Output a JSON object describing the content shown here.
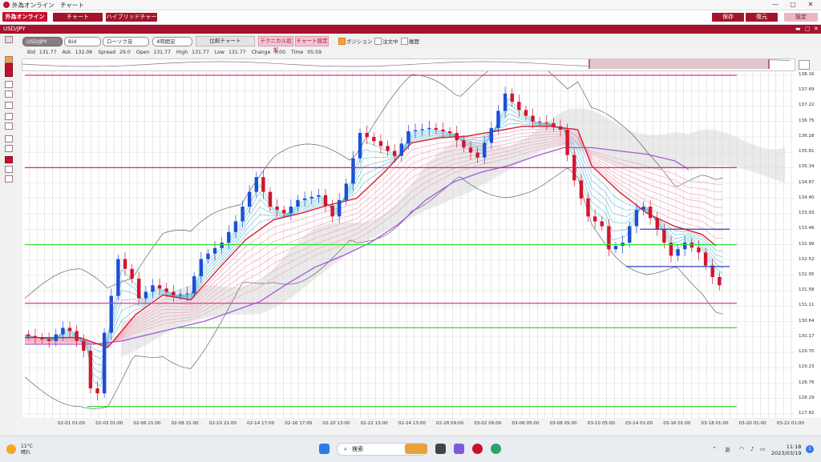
{
  "window": {
    "title": "外為オンライン　チャート",
    "minimize": "—",
    "maximize": "▢",
    "close": "✕"
  },
  "menubar": {
    "logo_text": "外為オンライン",
    "buttons": [
      "チャート",
      "ハイブリッドチャート"
    ],
    "save_label": "保存",
    "restore_label": "復元",
    "settings_label": "設定"
  },
  "pairbar": {
    "pair": "USD/JPY",
    "minimize": "▬",
    "maximize": "▢",
    "close": "✕"
  },
  "toolbar": {
    "symbol": "USD/JPY",
    "price_type": "Bid",
    "chart_type": "ローソク足",
    "timeframe": "4時間足",
    "compare_label": "比較チャート",
    "technical_add_label": "テクニカル追加",
    "chart_settings_label": "チャート設定",
    "position_label": "ポジション",
    "orders_label": "注文中",
    "history_label": "履歴",
    "position_checked": true,
    "orders_checked": false,
    "history_checked": false
  },
  "quote": {
    "bid_label": "Bid",
    "bid": "131.77",
    "ask_label": "Ask",
    "ask": "132.06",
    "spread_label": "Spread",
    "spread": "29.0",
    "open_label": "Open",
    "open": "131.77",
    "high_label": "High",
    "high": "131.77",
    "low_label": "Low",
    "low": "131.77",
    "change_label": "Change",
    "change": "0.00",
    "time_label": "Time",
    "time": "05:59"
  },
  "chart_data": {
    "type": "line",
    "pair": "USD/JPY",
    "timeframe": "4h",
    "y_ticks": [
      "138.16",
      "137.69",
      "137.22",
      "136.75",
      "136.28",
      "135.81",
      "135.34",
      "134.87",
      "134.40",
      "133.93",
      "133.46",
      "132.99",
      "132.52",
      "132.05",
      "131.58",
      "131.11",
      "130.64",
      "130.17",
      "129.70",
      "129.23",
      "128.76",
      "128.29",
      "127.82"
    ],
    "ylim": [
      127.82,
      138.16
    ],
    "x_ticks": [
      "02-01 01:00",
      "02-03 01:00",
      "02-06 21:00",
      "02-08 21:00",
      "02-10 21:00",
      "02-14 17:00",
      "02-16 17:00",
      "02-20 13:00",
      "02-22 13:00",
      "02-24 13:00",
      "02-28 09:00",
      "03-02 09:00",
      "03-06 05:00",
      "03-08 05:00",
      "03-10 05:00",
      "03-14 01:00",
      "03-16 01:00",
      "03-18 01:00",
      "03-20 01:00",
      "03-22 01:00"
    ],
    "price_path": [
      [
        0,
        130.25
      ],
      [
        4,
        130.05
      ],
      [
        6,
        130.45
      ],
      [
        7,
        130.35
      ],
      [
        9,
        129.75
      ],
      [
        10,
        128.6
      ],
      [
        11,
        128.45
      ],
      [
        12,
        130.3
      ],
      [
        14,
        132.55
      ],
      [
        16,
        131.95
      ],
      [
        17,
        131.35
      ],
      [
        19,
        131.75
      ],
      [
        22,
        131.45
      ],
      [
        24,
        131.5
      ],
      [
        26,
        132.55
      ],
      [
        29,
        133.05
      ],
      [
        31,
        133.7
      ],
      [
        34,
        135.05
      ],
      [
        36,
        134.15
      ],
      [
        38,
        133.95
      ],
      [
        40,
        134.35
      ],
      [
        43,
        134.5
      ],
      [
        45,
        133.85
      ],
      [
        47,
        134.85
      ],
      [
        49,
        136.4
      ],
      [
        51,
        136.15
      ],
      [
        54,
        135.7
      ],
      [
        56,
        136.45
      ],
      [
        59,
        136.55
      ],
      [
        62,
        136.4
      ],
      [
        64,
        135.95
      ],
      [
        66,
        135.65
      ],
      [
        68,
        136.55
      ],
      [
        70,
        137.6
      ],
      [
        72,
        137.1
      ],
      [
        74,
        136.75
      ],
      [
        76,
        136.7
      ],
      [
        78,
        136.5
      ],
      [
        80,
        134.95
      ],
      [
        82,
        133.85
      ],
      [
        84,
        133.55
      ],
      [
        85,
        132.85
      ],
      [
        87,
        133.05
      ],
      [
        89,
        134.05
      ],
      [
        90,
        134.15
      ],
      [
        92,
        133.45
      ],
      [
        94,
        132.65
      ],
      [
        96,
        133.05
      ],
      [
        98,
        132.75
      ],
      [
        99,
        132.35
      ],
      [
        100,
        132.0
      ],
      [
        101,
        131.75
      ]
    ],
    "ema_red": [
      [
        0,
        130.15
      ],
      [
        8,
        130.15
      ],
      [
        12,
        129.85
      ],
      [
        16,
        130.85
      ],
      [
        20,
        131.45
      ],
      [
        24,
        131.3
      ],
      [
        28,
        132.25
      ],
      [
        32,
        133.15
      ],
      [
        36,
        133.75
      ],
      [
        40,
        133.95
      ],
      [
        44,
        134.2
      ],
      [
        48,
        134.4
      ],
      [
        52,
        135.2
      ],
      [
        56,
        136.1
      ],
      [
        60,
        136.25
      ],
      [
        64,
        136.3
      ],
      [
        68,
        136.45
      ],
      [
        72,
        136.6
      ],
      [
        76,
        136.6
      ],
      [
        80,
        136.5
      ],
      [
        82,
        135.4
      ],
      [
        86,
        134.6
      ],
      [
        90,
        133.95
      ],
      [
        94,
        133.55
      ],
      [
        98,
        133.3
      ],
      [
        100,
        132.95
      ]
    ],
    "ma_purple": [
      [
        0,
        129.95
      ],
      [
        10,
        129.95
      ],
      [
        14,
        130.05
      ],
      [
        20,
        130.35
      ],
      [
        26,
        130.65
      ],
      [
        30,
        130.95
      ],
      [
        34,
        131.25
      ],
      [
        38,
        131.8
      ],
      [
        42,
        132.3
      ],
      [
        46,
        132.65
      ],
      [
        50,
        133.05
      ],
      [
        54,
        133.6
      ],
      [
        58,
        134.35
      ],
      [
        62,
        134.9
      ],
      [
        66,
        135.2
      ],
      [
        70,
        135.4
      ],
      [
        74,
        135.7
      ],
      [
        78,
        135.95
      ],
      [
        82,
        135.95
      ],
      [
        86,
        135.85
      ],
      [
        90,
        135.75
      ],
      [
        94,
        135.55
      ],
      [
        96,
        135.3
      ]
    ],
    "horizontal_lines": [
      {
        "price": 138.16,
        "color": "#e0359a",
        "from": 0,
        "to": 103
      },
      {
        "price": 135.34,
        "color": "#e8198a",
        "from": 0,
        "to": 103
      },
      {
        "price": 132.99,
        "color": "#33dd33",
        "from": 0,
        "to": 103
      },
      {
        "price": 131.2,
        "color": "#e0359a",
        "from": 0,
        "to": 103
      },
      {
        "price": 130.45,
        "color": "#33dd33",
        "from": 22,
        "to": 103
      },
      {
        "price": 128.05,
        "color": "#33dd33",
        "from": 9,
        "to": 103
      },
      {
        "price": 133.46,
        "color": "#2b3fc8",
        "from": 89,
        "to": 102
      },
      {
        "price": 132.32,
        "color": "#2b3fc8",
        "from": 87,
        "to": 102
      }
    ],
    "grid": true,
    "colors": {
      "up_candle": "#1c4fd6",
      "down_candle": "#d4142c",
      "ema": "#e01a2a",
      "ma": "#a855d8",
      "ribbon_fast": "#3fb1cf",
      "ribbon_slow": "#f4a7bd",
      "bollinger": "#666666",
      "cloud": "#d8d8d8"
    }
  },
  "taskbar": {
    "temperature": "11°C",
    "weather": "晴れ",
    "search_placeholder": "検索",
    "ime": "あ",
    "time": "11:18",
    "date": "2023/03/19",
    "notifications": "1"
  }
}
